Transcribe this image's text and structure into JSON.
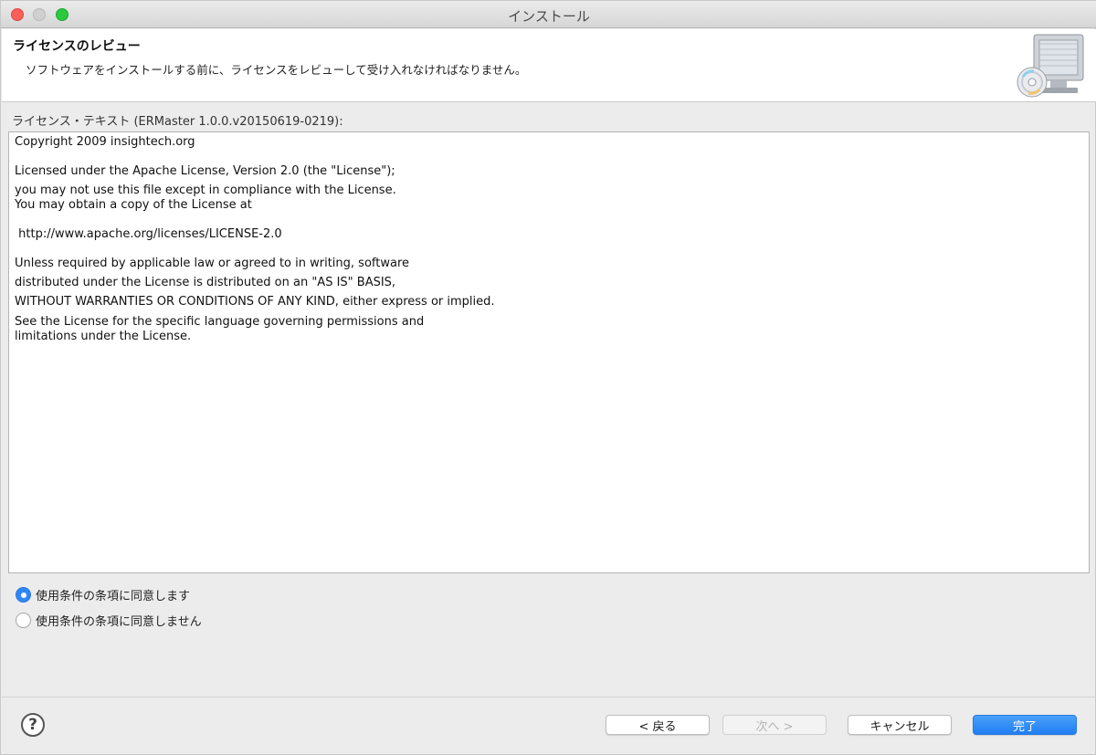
{
  "window": {
    "title": "インストール"
  },
  "header": {
    "title": "ライセンスのレビュー",
    "description": "ソフトウェアをインストールする前に、ライセンスをレビューして受け入れなければなりません。"
  },
  "license": {
    "label": "ライセンス・テキスト (ERMaster 1.0.0.v20150619-0219):",
    "lines": [
      "Copyright 2009 insightech.org",
      "Licensed under the Apache License, Version 2.0 (the \"License\");",
      "you may not use this file except in compliance with the License.",
      "You may obtain a copy of the License at",
      " http://www.apache.org/licenses/LICENSE-2.0",
      "Unless required by applicable law or agreed to in writing, software",
      "distributed under the License is distributed on an \"AS IS\" BASIS,",
      "WITHOUT WARRANTIES OR CONDITIONS OF ANY KIND, either express or implied.",
      "See the License for the specific language governing permissions and",
      "limitations under the License."
    ]
  },
  "options": {
    "accept": "使用条件の条項に同意します",
    "decline": "使用条件の条項に同意しません",
    "selected": "accept"
  },
  "buttons": {
    "help": "?",
    "back": "< 戻る",
    "next": "次へ >",
    "cancel": "キャンセル",
    "finish": "完了"
  },
  "colors": {
    "accent": "#2f87f5",
    "close": "#fc5f57",
    "maximize": "#2ac940"
  },
  "icons": {
    "header": "install-cd-computer-icon",
    "help": "help-question-icon"
  }
}
